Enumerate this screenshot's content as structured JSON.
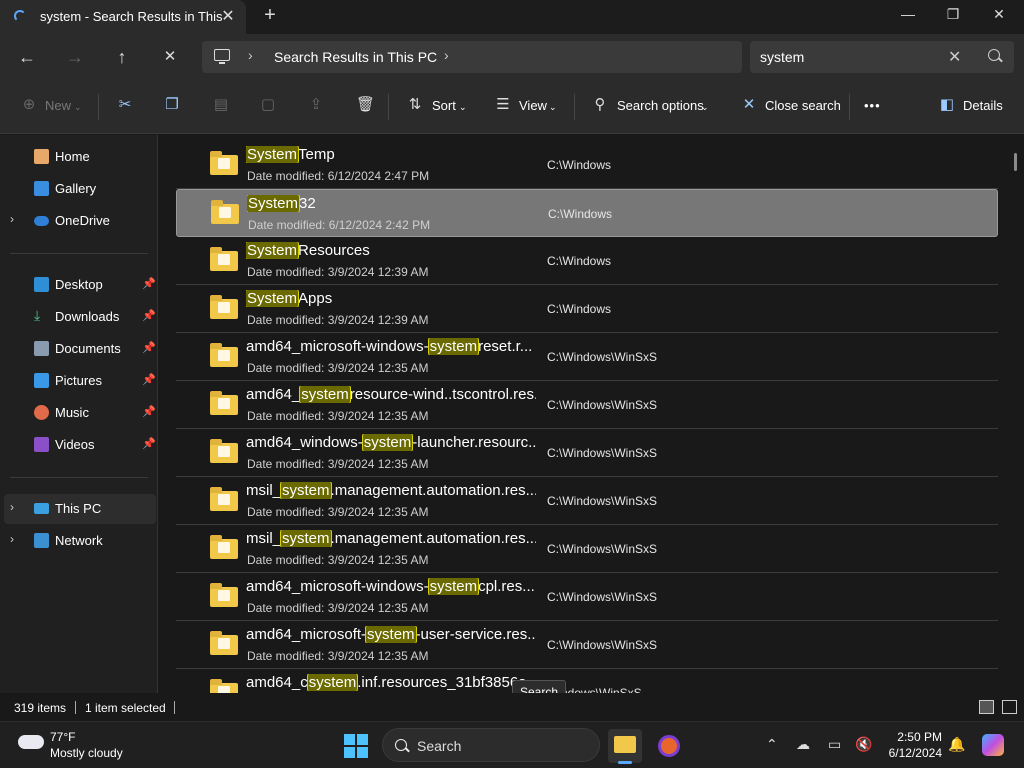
{
  "window": {
    "tab_title": "system - Search Results in This",
    "close_tab": "✕",
    "new_tab": "+",
    "minimize": "—",
    "maximize": "❐",
    "close": "✕"
  },
  "nav": {
    "back": "←",
    "forward": "→",
    "up": "↑",
    "stop": "✕",
    "breadcrumb": "Search Results in This PC",
    "search_value": "system"
  },
  "toolbar": {
    "new": "New",
    "sort": "Sort",
    "view": "View",
    "search_options": "Search options",
    "close_search": "Close search",
    "more": "•••",
    "details": "Details"
  },
  "sidebar": {
    "items": [
      {
        "label": "Home"
      },
      {
        "label": "Gallery"
      },
      {
        "label": "OneDrive"
      },
      {
        "label": "Desktop"
      },
      {
        "label": "Downloads"
      },
      {
        "label": "Documents"
      },
      {
        "label": "Pictures"
      },
      {
        "label": "Music"
      },
      {
        "label": "Videos"
      },
      {
        "label": "This PC"
      },
      {
        "label": "Network"
      }
    ]
  },
  "files": [
    {
      "pre": "",
      "hl": "System",
      "post": "Temp",
      "date": "Date modified: 6/12/2024 2:47 PM",
      "loc": "C:\\Windows"
    },
    {
      "pre": "",
      "hl": "System",
      "post": "32",
      "date": "Date modified: 6/12/2024 2:42 PM",
      "loc": "C:\\Windows"
    },
    {
      "pre": "",
      "hl": "System",
      "post": "Resources",
      "date": "Date modified: 3/9/2024 12:39 AM",
      "loc": "C:\\Windows"
    },
    {
      "pre": "",
      "hl": "System",
      "post": "Apps",
      "date": "Date modified: 3/9/2024 12:39 AM",
      "loc": "C:\\Windows"
    },
    {
      "pre": "amd64_microsoft-windows-",
      "hl": "system",
      "post": "reset.r...",
      "date": "Date modified: 3/9/2024 12:35 AM",
      "loc": "C:\\Windows\\WinSxS"
    },
    {
      "pre": "amd64_",
      "hl": "system",
      "post": "resource-wind..tscontrol.res...",
      "date": "Date modified: 3/9/2024 12:35 AM",
      "loc": "C:\\Windows\\WinSxS"
    },
    {
      "pre": "amd64_windows-",
      "hl": "system",
      "post": "-launcher.resourc...",
      "date": "Date modified: 3/9/2024 12:35 AM",
      "loc": "C:\\Windows\\WinSxS"
    },
    {
      "pre": "msil_",
      "hl": "system",
      "post": ".management.automation.res...",
      "date": "Date modified: 3/9/2024 12:35 AM",
      "loc": "C:\\Windows\\WinSxS"
    },
    {
      "pre": "msil_",
      "hl": "system",
      "post": ".management.automation.res...",
      "date": "Date modified: 3/9/2024 12:35 AM",
      "loc": "C:\\Windows\\WinSxS"
    },
    {
      "pre": "amd64_microsoft-windows-",
      "hl": "system",
      "post": "cpl.res...",
      "date": "Date modified: 3/9/2024 12:35 AM",
      "loc": "C:\\Windows\\WinSxS"
    },
    {
      "pre": "amd64_microsoft-",
      "hl": "system",
      "post": "-user-service.res...",
      "date": "Date modified: 3/9/2024 12:35 AM",
      "loc": "C:\\Windows\\WinSxS"
    },
    {
      "pre": "amd64_c",
      "hl": "system",
      "post": ".inf.resources_31bf3856a...",
      "date": "",
      "loc": "Windows\\WinSxS"
    }
  ],
  "tooltip": "Search",
  "status": {
    "count": "319 items",
    "selected": "1 item selected"
  },
  "taskbar": {
    "temp": "77°F",
    "weather": "Mostly cloudy",
    "search": "Search",
    "time": "2:50 PM",
    "date": "6/12/2024"
  }
}
